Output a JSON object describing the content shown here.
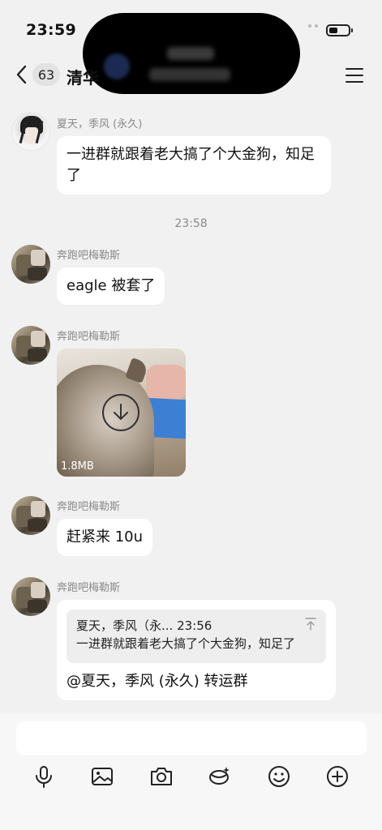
{
  "status": {
    "time": "23:59"
  },
  "nav": {
    "unread_count": "63",
    "title_partial": "清华"
  },
  "messages": [
    {
      "sender": "夏天，季风 (永久)",
      "text": "一进群就跟着老大搞了个大金狗，知足了"
    },
    {
      "sender": "奔跑吧梅勒斯",
      "text": "eagle 被套了"
    },
    {
      "sender": "奔跑吧梅勒斯",
      "media_size": "1.8MB"
    },
    {
      "sender": "奔跑吧梅勒斯",
      "text": "赶紧来 10u"
    },
    {
      "sender": "奔跑吧梅勒斯",
      "quote_header": "夏天，季风（永... 23:56",
      "quote_text": "一进群就跟着老大搞了个大金狗，知足了",
      "reply": "@夏天，季风 (永久) 转运群"
    }
  ],
  "timestamp_divider": "23:58",
  "input": {
    "placeholder": ""
  },
  "toolbar": [
    "microphone-icon",
    "image-icon",
    "camera-icon",
    "red-packet-icon",
    "emoji-icon",
    "plus-icon"
  ]
}
